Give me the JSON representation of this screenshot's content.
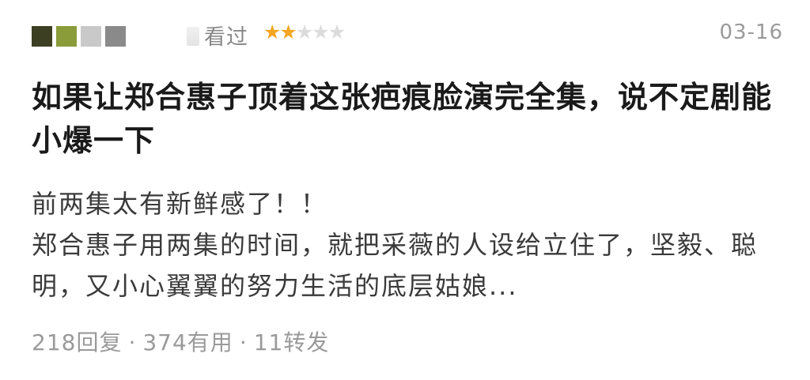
{
  "header": {
    "avatar_colors": [
      "#3d3f22",
      "#8a9b3a",
      "#c9c9c9",
      "#8a8a8a"
    ],
    "action": "看过",
    "rating": 2,
    "rating_max": 5,
    "star_icon": "star-icon",
    "date": "03-16"
  },
  "review": {
    "title": "如果让郑合惠子顶着这张疤痕脸演完全集，说不定剧能小爆一下",
    "body": [
      "前两集太有新鲜感了！！",
      "郑合惠子用两集的时间，就把采薇的人设给立住了，坚毅、聪明，又小心翼翼的努力生活的底层姑娘..."
    ]
  },
  "stats": {
    "replies": "218回复",
    "useful": "374有用",
    "reposts": "11转发",
    "separator": "·"
  },
  "colors": {
    "star_on": "#f5a623",
    "star_off": "#dcdcdc",
    "meta_text": "#9a9a9a",
    "title_text": "#1a1a1a",
    "body_text": "#3a3a3a"
  }
}
